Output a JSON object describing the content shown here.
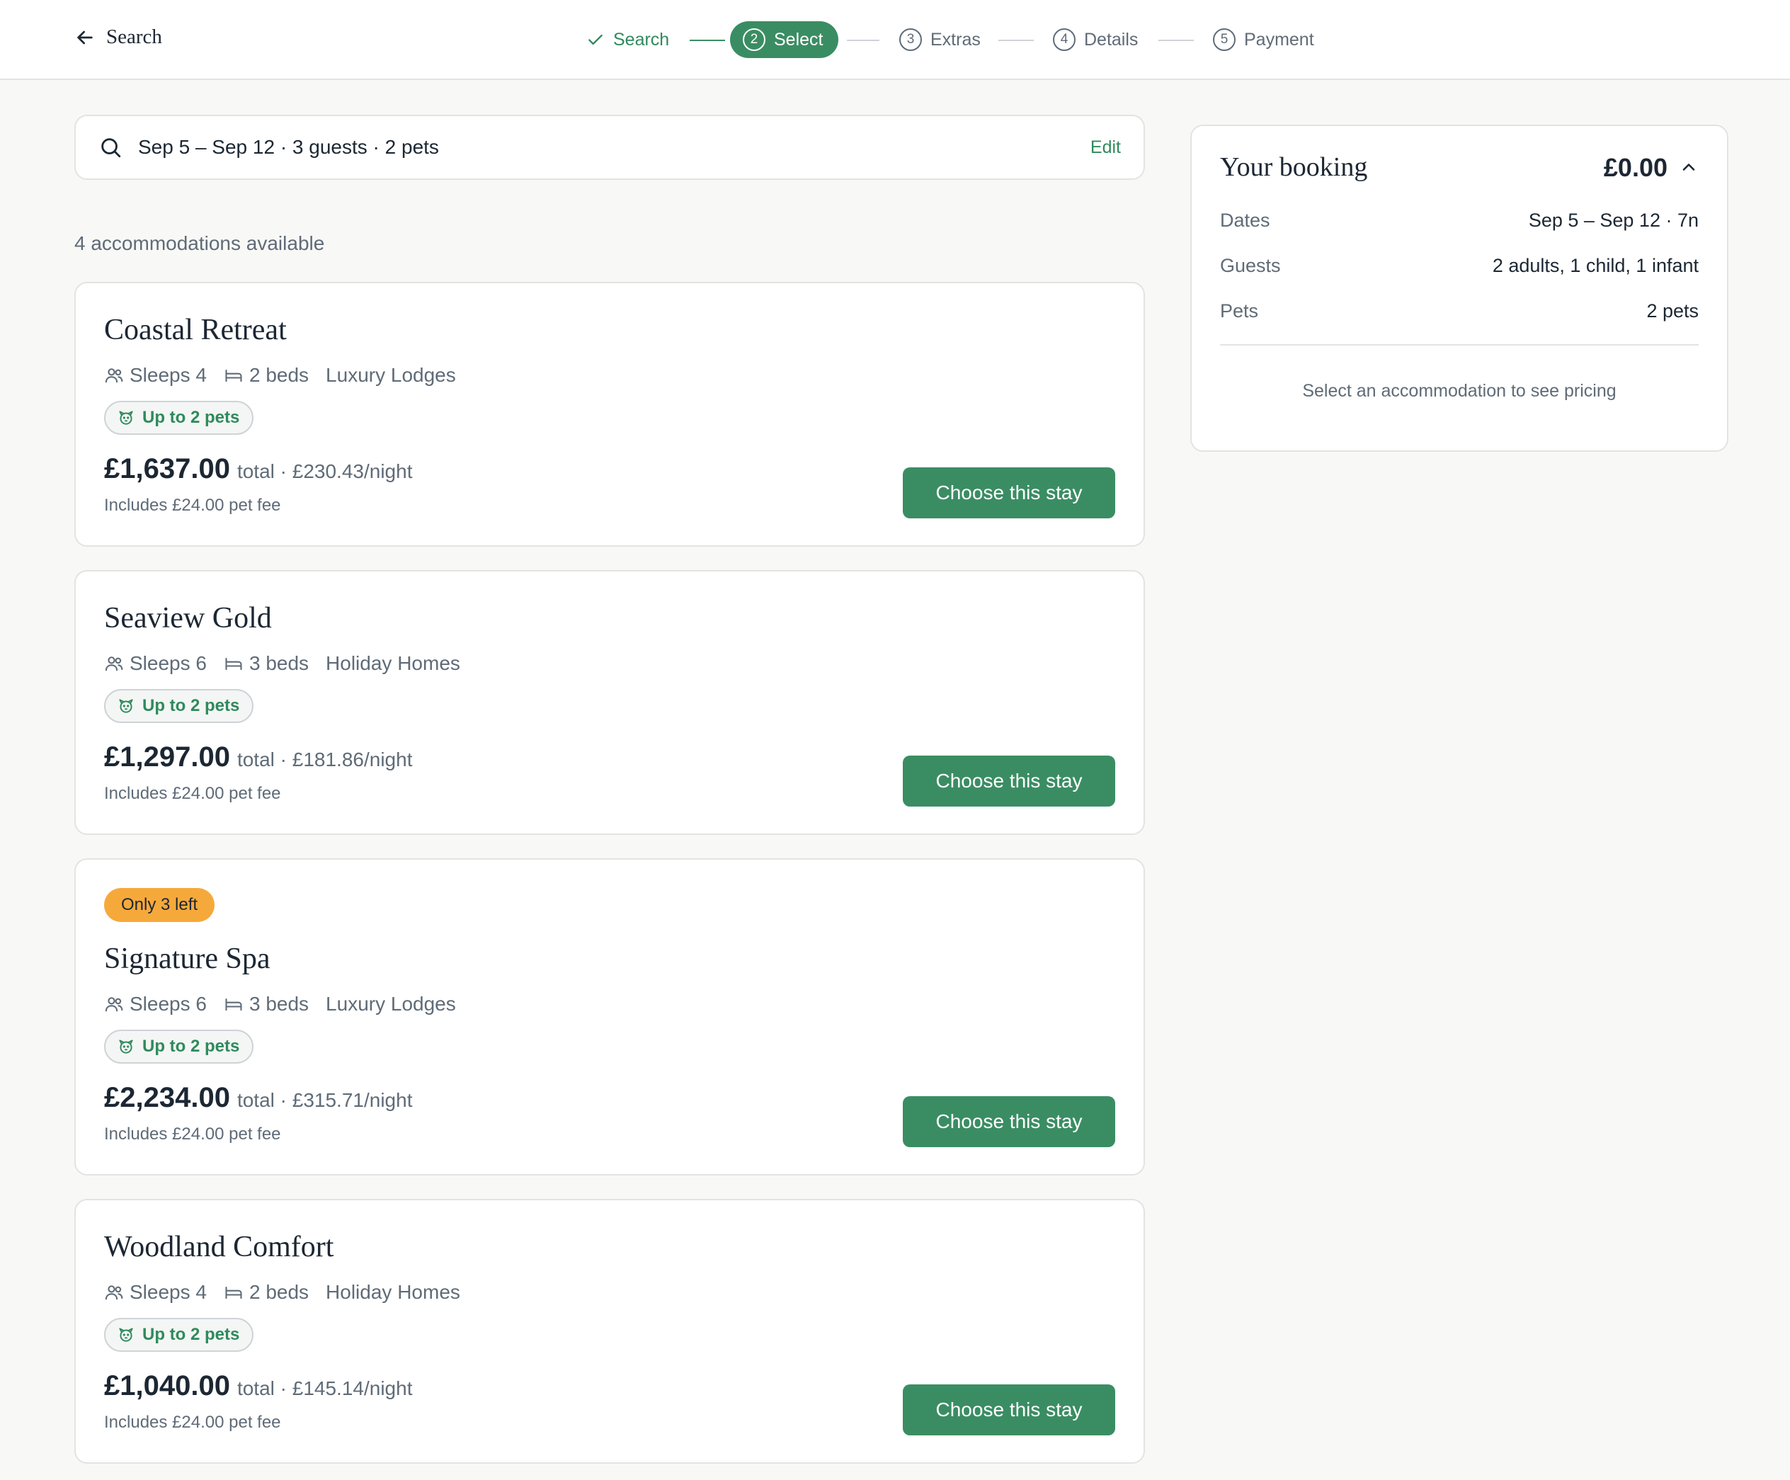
{
  "header": {
    "back_label": "Search",
    "steps": [
      {
        "num": "",
        "label": "Search",
        "state": "done"
      },
      {
        "num": "2",
        "label": "Select",
        "state": "active"
      },
      {
        "num": "3",
        "label": "Extras",
        "state": "upcoming"
      },
      {
        "num": "4",
        "label": "Details",
        "state": "upcoming"
      },
      {
        "num": "5",
        "label": "Payment",
        "state": "upcoming"
      }
    ]
  },
  "search": {
    "summary": "Sep 5 – Sep 12 · 3 guests · 2 pets",
    "edit_label": "Edit"
  },
  "results_count": "4 accommodations available",
  "accommodations": [
    {
      "name": "Coastal Retreat",
      "sleeps": "Sleeps 4",
      "beds": "2 beds",
      "category": "Luxury Lodges",
      "pets": "Up to 2 pets",
      "price": "£1,637.00",
      "price_sub": "total · £230.43/night",
      "fee": "Includes £24.00 pet fee",
      "cta": "Choose this stay"
    },
    {
      "name": "Seaview Gold",
      "sleeps": "Sleeps 6",
      "beds": "3 beds",
      "category": "Holiday Homes",
      "pets": "Up to 2 pets",
      "price": "£1,297.00",
      "price_sub": "total · £181.86/night",
      "fee": "Includes £24.00 pet fee",
      "cta": "Choose this stay"
    },
    {
      "badge": "Only 3 left",
      "name": "Signature Spa",
      "sleeps": "Sleeps 6",
      "beds": "3 beds",
      "category": "Luxury Lodges",
      "pets": "Up to 2 pets",
      "price": "£2,234.00",
      "price_sub": "total · £315.71/night",
      "fee": "Includes £24.00 pet fee",
      "cta": "Choose this stay"
    },
    {
      "name": "Woodland Comfort",
      "sleeps": "Sleeps 4",
      "beds": "2 beds",
      "category": "Holiday Homes",
      "pets": "Up to 2 pets",
      "price": "£1,040.00",
      "price_sub": "total · £145.14/night",
      "fee": "Includes £24.00 pet fee",
      "cta": "Choose this stay"
    }
  ],
  "booking": {
    "title": "Your booking",
    "total": "£0.00",
    "rows": [
      {
        "label": "Dates",
        "value": "Sep 5 – Sep 12 · 7n"
      },
      {
        "label": "Guests",
        "value": "2 adults, 1 child, 1 infant"
      },
      {
        "label": "Pets",
        "value": "2 pets"
      }
    ],
    "hint": "Select an accommodation to see pricing"
  },
  "colors": {
    "accent": "#3a8d63",
    "background": "#f8f8f6",
    "scarcity": "#f6a93b"
  }
}
